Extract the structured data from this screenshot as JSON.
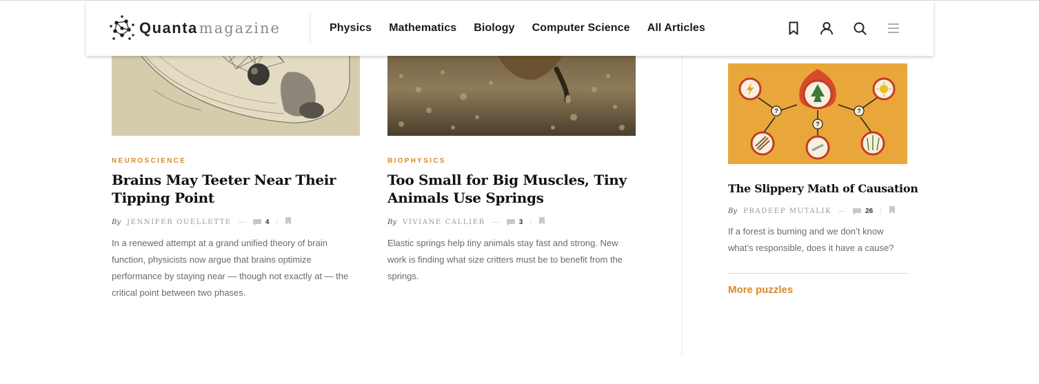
{
  "brand": {
    "name_bold": "Quanta",
    "name_light": "magazine"
  },
  "nav": [
    "Physics",
    "Mathematics",
    "Biology",
    "Computer Science",
    "All Articles"
  ],
  "header_icons": [
    "bookmark-icon",
    "user-icon",
    "search-icon",
    "menu-icon"
  ],
  "articles": [
    {
      "kicker": "NEUROSCIENCE",
      "title": "Brains May Teeter Near Their Tipping Point",
      "by": "By",
      "author": "JENNIFER OUELLETTE",
      "comments": "4",
      "excerpt": "In a renewed attempt at a grand unified theory of brain function, physicists now argue that brains optimize performance by staying near — though not exactly at — the critical point between two phases."
    },
    {
      "kicker": "BIOPHYSICS",
      "title": "Too Small for Big Muscles, Tiny Animals Use Springs",
      "by": "By",
      "author": "VIVIANE CALLIER",
      "comments": "3",
      "excerpt": "Elastic springs help tiny animals stay fast and strong. New work is finding what size critters must be to benefit from the springs."
    }
  ],
  "sidebar": {
    "title": "The Slippery Math of Causation",
    "by": "By",
    "author": "PRADEEP MUTALIK",
    "comments": "26",
    "excerpt": "If a forest is burning and we don’t know what’s responsible, does it have a cause?",
    "more_label": "More puzzles"
  },
  "colors": {
    "accent": "#d8882a",
    "text": "#1a1a1a",
    "muted": "#6a6a6a",
    "illustration_bg": "#e9a63a"
  }
}
